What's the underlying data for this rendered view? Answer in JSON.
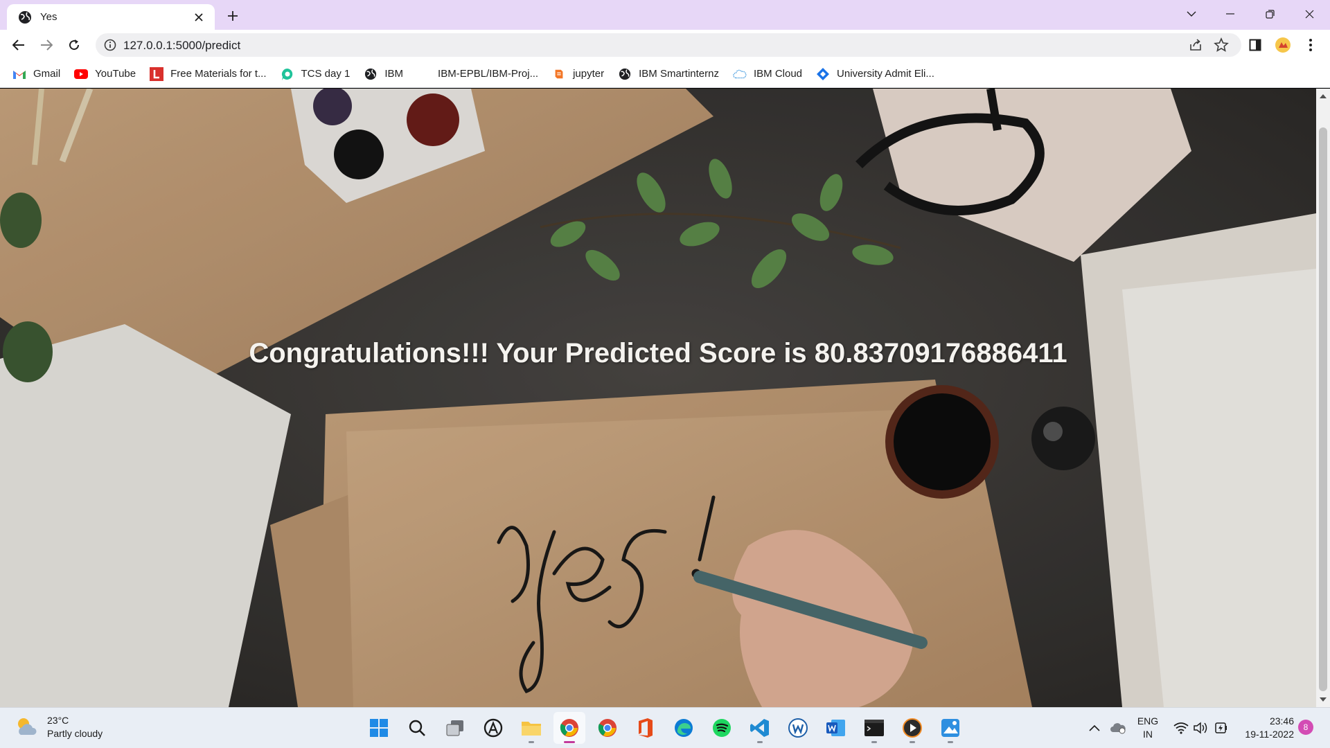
{
  "browser": {
    "tab": {
      "title": "Yes"
    },
    "address_bar": {
      "url": "127.0.0.1:5000/predict"
    },
    "bookmarks": [
      {
        "label": "Gmail",
        "icon": "gmail-icon"
      },
      {
        "label": "YouTube",
        "icon": "youtube-icon"
      },
      {
        "label": "Free Materials for t...",
        "icon": "l-logo-icon"
      },
      {
        "label": "TCS day 1",
        "icon": "chat-icon"
      },
      {
        "label": "IBM",
        "icon": "globe-icon"
      },
      {
        "label": "IBM-EPBL/IBM-Proj...",
        "icon": "github-icon"
      },
      {
        "label": "jupyter",
        "icon": "jupyter-icon"
      },
      {
        "label": "IBM Smartinternz",
        "icon": "globe-icon"
      },
      {
        "label": "IBM Cloud",
        "icon": "cloud-icon"
      },
      {
        "label": "University Admit Eli...",
        "icon": "diamond-icon"
      }
    ]
  },
  "page": {
    "headline": "Congratulations!!! Your Predicted Score is 80.83709176886411"
  },
  "taskbar": {
    "weather": {
      "temperature": "23°C",
      "condition": "Partly cloudy"
    },
    "language": {
      "line1": "ENG",
      "line2": "IN"
    },
    "clock": {
      "time": "23:46",
      "date": "19-11-2022"
    },
    "notification_count": "8"
  },
  "colors": {
    "titlebar": "#e7d7f7",
    "taskbar": "#e9eef5",
    "headline_text": "#f5f3ef"
  }
}
